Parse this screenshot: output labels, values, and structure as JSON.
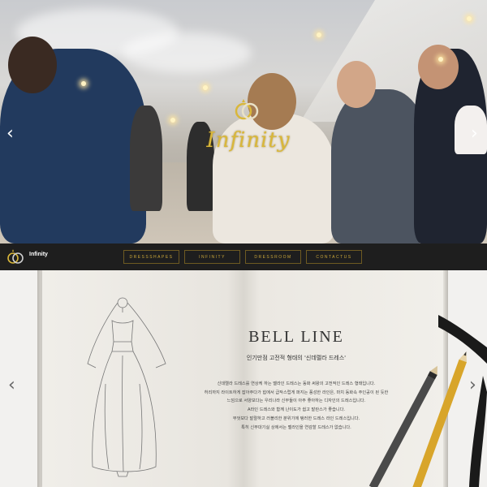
{
  "hero": {
    "logo_text": "Infinity",
    "prev_icon": "chevron-left-icon",
    "next_icon": "chevron-right-icon"
  },
  "navbar": {
    "brand": "Infinity",
    "logo_icon": "rings-icon",
    "menu": [
      {
        "label": "DRESSSHAPES"
      },
      {
        "label": "INFINITY"
      },
      {
        "label": "DRESSROOM"
      },
      {
        "label": "CONTACTUS"
      }
    ],
    "accent_color": "#c9a63a",
    "background_color": "#1e1e1e"
  },
  "book": {
    "title": "BELL LINE",
    "subtitle": "인기만점 고전적 형태의 '신데렐라 드레스'",
    "description": [
      "신데렐라 드레스를 연상케 하는 벨라인 드레스는 동화 써왕의 고전적인 드레스 형태입니다.",
      "허리까지 라이트하게 잡아주다가 힙에서 급작스럽게 퍼지는 풍성한 라인은, 마치 동화속 주인공이 된 듯한",
      "느낌으로 서양보다는 우리나라 신부들이 아주 좋아하는 디자인의 드레스입니다.",
      "A라인 드레스와 함께 난이도가 쉽고 발란스가 좋습니다.",
      "무엇보다 발랄하고 러블리한 분위기에 탱러한 드레스 라인 드레스입니다.",
      "특히 신부대기실 상에서는 벨라인을 연감할 드레스가 없습니다."
    ],
    "prev_icon": "chevron-left-icon",
    "next_icon": "chevron-right-icon"
  }
}
